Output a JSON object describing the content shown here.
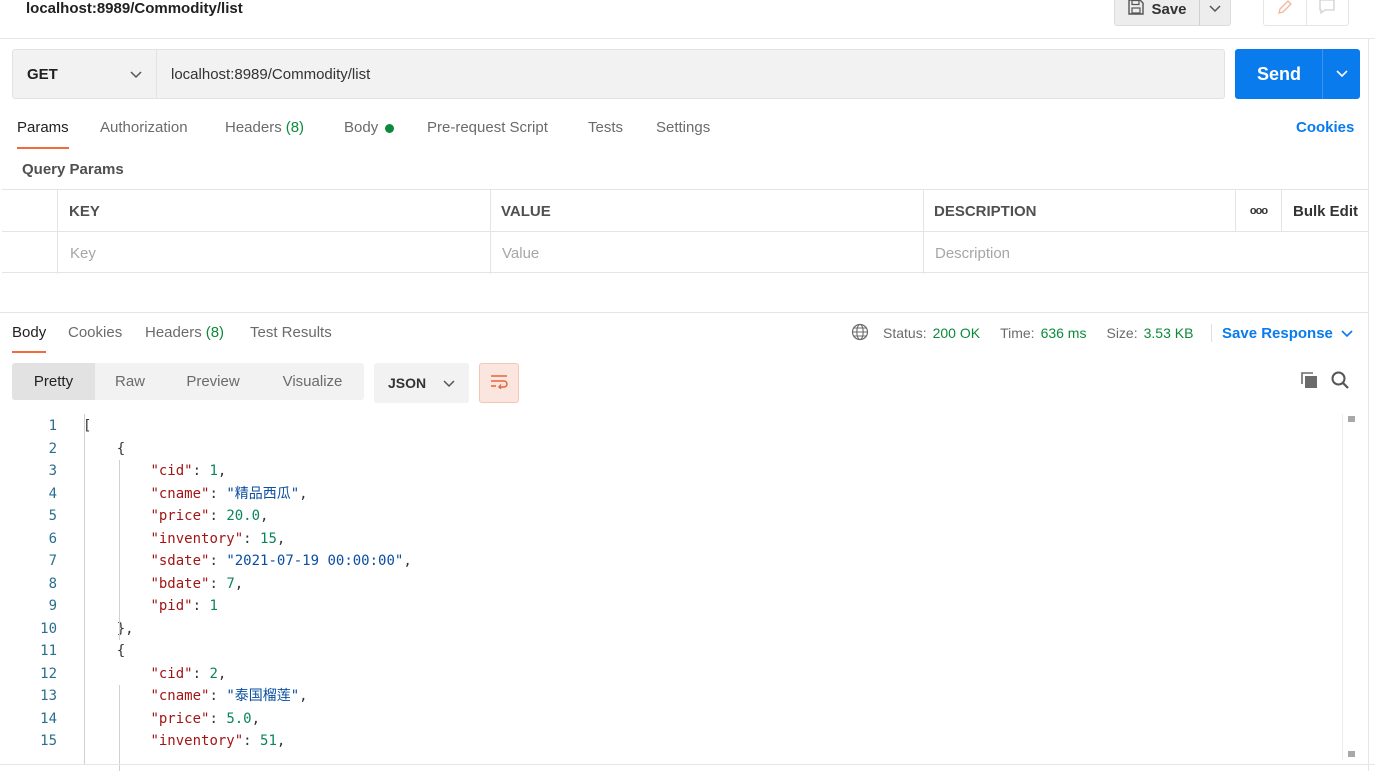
{
  "title": "localhost:8989/Commodity/list",
  "toolbar": {
    "save_label": "Save"
  },
  "request": {
    "method": "GET",
    "url": "localhost:8989/Commodity/list",
    "send_label": "Send"
  },
  "request_tabs": {
    "params": "Params",
    "authorization": "Authorization",
    "headers": "Headers",
    "headers_count": "(8)",
    "body": "Body",
    "prerequest": "Pre-request Script",
    "tests": "Tests",
    "settings": "Settings",
    "cookies": "Cookies"
  },
  "query_params": {
    "label": "Query Params",
    "columns": {
      "key": "KEY",
      "value": "VALUE",
      "description": "DESCRIPTION",
      "bulk_edit": "Bulk Edit",
      "more": "ooo"
    },
    "placeholders": {
      "key": "Key",
      "value": "Value",
      "description": "Description"
    }
  },
  "response_tabs": {
    "body": "Body",
    "cookies": "Cookies",
    "headers": "Headers",
    "headers_count": "(8)",
    "test_results": "Test Results"
  },
  "status": {
    "status_label": "Status:",
    "status_value": "200 OK",
    "time_label": "Time:",
    "time_value": "636 ms",
    "size_label": "Size:",
    "size_value": "3.53 KB",
    "save_response": "Save Response"
  },
  "format": {
    "pretty": "Pretty",
    "raw": "Raw",
    "preview": "Preview",
    "visualize": "Visualize",
    "language": "JSON"
  },
  "code_lines": [
    {
      "n": "1",
      "parts": [
        [
          "p",
          "["
        ]
      ]
    },
    {
      "n": "2",
      "parts": [
        [
          "p",
          "    {"
        ]
      ]
    },
    {
      "n": "3",
      "parts": [
        [
          "p",
          "        "
        ],
        [
          "k",
          "\"cid\""
        ],
        [
          "p",
          ": "
        ],
        [
          "n",
          "1"
        ],
        [
          "p",
          ","
        ]
      ]
    },
    {
      "n": "4",
      "parts": [
        [
          "p",
          "        "
        ],
        [
          "k",
          "\"cname\""
        ],
        [
          "p",
          ": "
        ],
        [
          "s",
          "\"精品西瓜\""
        ],
        [
          "p",
          ","
        ]
      ]
    },
    {
      "n": "5",
      "parts": [
        [
          "p",
          "        "
        ],
        [
          "k",
          "\"price\""
        ],
        [
          "p",
          ": "
        ],
        [
          "n",
          "20.0"
        ],
        [
          "p",
          ","
        ]
      ]
    },
    {
      "n": "6",
      "parts": [
        [
          "p",
          "        "
        ],
        [
          "k",
          "\"inventory\""
        ],
        [
          "p",
          ": "
        ],
        [
          "n",
          "15"
        ],
        [
          "p",
          ","
        ]
      ]
    },
    {
      "n": "7",
      "parts": [
        [
          "p",
          "        "
        ],
        [
          "k",
          "\"sdate\""
        ],
        [
          "p",
          ": "
        ],
        [
          "s",
          "\"2021-07-19 00:00:00\""
        ],
        [
          "p",
          ","
        ]
      ]
    },
    {
      "n": "8",
      "parts": [
        [
          "p",
          "        "
        ],
        [
          "k",
          "\"bdate\""
        ],
        [
          "p",
          ": "
        ],
        [
          "n",
          "7"
        ],
        [
          "p",
          ","
        ]
      ]
    },
    {
      "n": "9",
      "parts": [
        [
          "p",
          "        "
        ],
        [
          "k",
          "\"pid\""
        ],
        [
          "p",
          ": "
        ],
        [
          "n",
          "1"
        ]
      ]
    },
    {
      "n": "10",
      "parts": [
        [
          "p",
          "    },"
        ]
      ]
    },
    {
      "n": "11",
      "parts": [
        [
          "p",
          "    {"
        ]
      ]
    },
    {
      "n": "12",
      "parts": [
        [
          "p",
          "        "
        ],
        [
          "k",
          "\"cid\""
        ],
        [
          "p",
          ": "
        ],
        [
          "n",
          "2"
        ],
        [
          "p",
          ","
        ]
      ]
    },
    {
      "n": "13",
      "parts": [
        [
          "p",
          "        "
        ],
        [
          "k",
          "\"cname\""
        ],
        [
          "p",
          ": "
        ],
        [
          "s",
          "\"泰国榴莲\""
        ],
        [
          "p",
          ","
        ]
      ]
    },
    {
      "n": "14",
      "parts": [
        [
          "p",
          "        "
        ],
        [
          "k",
          "\"price\""
        ],
        [
          "p",
          ": "
        ],
        [
          "n",
          "5.0"
        ],
        [
          "p",
          ","
        ]
      ]
    },
    {
      "n": "15",
      "parts": [
        [
          "p",
          "        "
        ],
        [
          "k",
          "\"inventory\""
        ],
        [
          "p",
          ": "
        ],
        [
          "n",
          "51"
        ],
        [
          "p",
          ","
        ]
      ]
    }
  ],
  "icons": {
    "save": "save-icon",
    "edit": "pencil-icon",
    "comment": "comment-icon",
    "globe": "globe-icon",
    "wrap": "wrap-lines-icon",
    "copy": "copy-icon",
    "search": "search-icon"
  },
  "colors": {
    "accent": "#097bed",
    "tab_underline": "#f26b3a",
    "success": "#0c8a3b"
  }
}
